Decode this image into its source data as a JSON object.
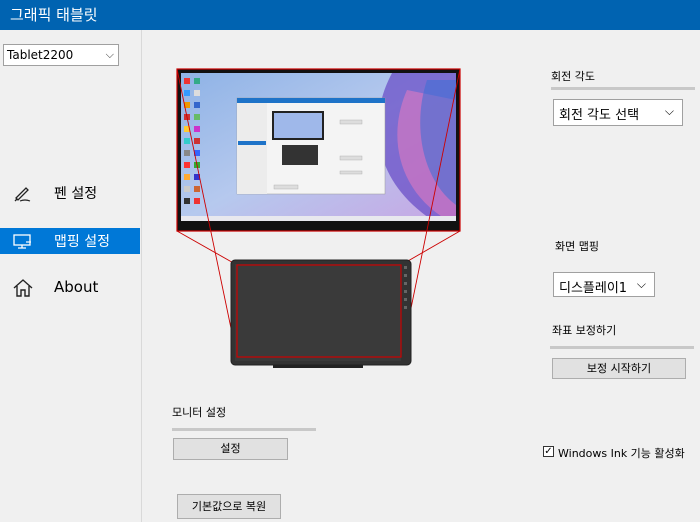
{
  "window": {
    "title": "그래픽 태블릿"
  },
  "sidebar": {
    "device": {
      "selected": "Tablet2200"
    },
    "items": [
      {
        "label": "펜 설정",
        "icon": "pen-icon"
      },
      {
        "label": "맵핑 설정",
        "icon": "monitor-icon",
        "active": true
      },
      {
        "label": "About",
        "icon": "home-icon"
      }
    ]
  },
  "rotation": {
    "label": "회전 각도",
    "selected": "회전 각도 선택"
  },
  "screen_mapping": {
    "label": "화면 맵핑",
    "selected": "디스플레이1"
  },
  "calibration": {
    "label": "좌표 보정하기",
    "button": "보정 시작하기"
  },
  "monitor": {
    "label": "모니터 설정",
    "button": "설정"
  },
  "windows_ink": {
    "label": "Windows Ink 기능 활성화",
    "checked": true
  },
  "restore_defaults": {
    "button": "기본값으로 복원"
  },
  "colors": {
    "accent": "#0078d7",
    "titlebar": "#0063b1",
    "mapping_line": "#cc0000"
  }
}
